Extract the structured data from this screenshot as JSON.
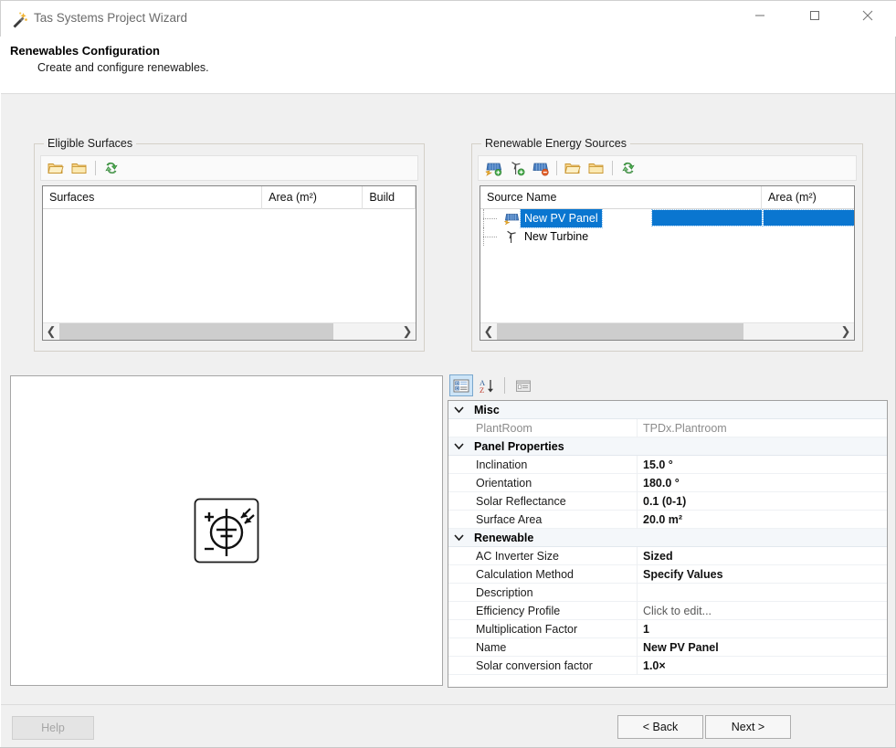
{
  "window": {
    "title": "Tas Systems Project Wizard",
    "icon": "magic-wand-icon",
    "minimize_label": "—",
    "maximize_label": "□",
    "close_label": "✕"
  },
  "header": {
    "title": "Renewables Configuration",
    "subtitle": "Create and configure renewables."
  },
  "eligible_surfaces": {
    "group_title": "Eligible Surfaces",
    "toolbar": [
      {
        "name": "open-folder-icon",
        "tooltip": "Open"
      },
      {
        "name": "folder-icon",
        "tooltip": "Folder"
      },
      {
        "name": "refresh-icon",
        "tooltip": "Refresh"
      }
    ],
    "columns": [
      "Surfaces",
      "Area (m²)",
      "Build"
    ],
    "rows": []
  },
  "renewable_sources": {
    "group_title": "Renewable Energy Sources",
    "toolbar": [
      {
        "name": "add-pv-panel-icon",
        "tooltip": "Add PV Panel"
      },
      {
        "name": "add-turbine-icon",
        "tooltip": "Add Turbine"
      },
      {
        "name": "remove-source-icon",
        "tooltip": "Remove Source"
      },
      {
        "name": "open-folder-icon",
        "tooltip": "Open"
      },
      {
        "name": "folder-icon",
        "tooltip": "Folder"
      },
      {
        "name": "refresh-icon",
        "tooltip": "Refresh"
      }
    ],
    "columns": [
      "Source Name",
      "Area (m²)"
    ],
    "rows": [
      {
        "label": "New PV Panel",
        "icon": "pv-panel-icon",
        "selected": true,
        "area": ""
      },
      {
        "label": "New Turbine",
        "icon": "wind-turbine-icon",
        "selected": false,
        "area": ""
      }
    ]
  },
  "preview": {
    "symbol": "photovoltaic-cell-symbol"
  },
  "property_grid": {
    "toolbar": [
      {
        "name": "categorized-view-icon",
        "active": true
      },
      {
        "name": "alphabetical-sort-icon",
        "active": false
      },
      {
        "name": "property-pages-icon",
        "active": false
      }
    ],
    "categories": [
      {
        "name": "Misc",
        "expanded": true,
        "rows": [
          {
            "name": "PlantRoom",
            "value": "TPDx.Plantroom",
            "style": "dim"
          }
        ]
      },
      {
        "name": "Panel Properties",
        "expanded": true,
        "rows": [
          {
            "name": "Inclination",
            "value": "15.0 °",
            "style": "normal"
          },
          {
            "name": "Orientation",
            "value": "180.0 °",
            "style": "normal"
          },
          {
            "name": "Solar Reflectance",
            "value": "0.1 (0-1)",
            "style": "normal"
          },
          {
            "name": "Surface Area",
            "value": "20.0 m²",
            "style": "normal"
          }
        ]
      },
      {
        "name": "Renewable",
        "expanded": true,
        "rows": [
          {
            "name": "AC Inverter Size",
            "value": "Sized",
            "style": "normal"
          },
          {
            "name": "Calculation Method",
            "value": "Specify Values",
            "style": "normal"
          },
          {
            "name": "Description",
            "value": "",
            "style": "normal"
          },
          {
            "name": "Efficiency Profile",
            "value": "Click to edit...",
            "style": "link"
          },
          {
            "name": "Multiplication Factor",
            "value": "1",
            "style": "normal"
          },
          {
            "name": "Name",
            "value": "New PV Panel",
            "style": "normal"
          },
          {
            "name": "Solar conversion factor",
            "value": "1.0×",
            "style": "normal"
          }
        ]
      }
    ]
  },
  "footer": {
    "help_label": "Help",
    "back_label": "< Back",
    "next_label": "Next >"
  },
  "colors": {
    "selection_blue": "#0a76d0",
    "window_bg": "#f0f0f0",
    "accent_orange": "#e8a33d"
  }
}
